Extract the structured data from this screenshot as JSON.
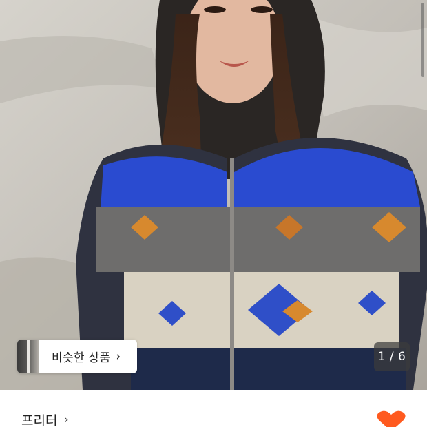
{
  "gallery": {
    "similar_products_label": "비슷한 상품",
    "similar_products_arrow": "›",
    "page_counter": "1 / 6",
    "current_page": 1,
    "total_pages": 6
  },
  "product": {
    "brand_name": "프리터",
    "brand_arrow": "›",
    "like_icon": "heart-icon",
    "accent_color": "#ff5a1f"
  }
}
